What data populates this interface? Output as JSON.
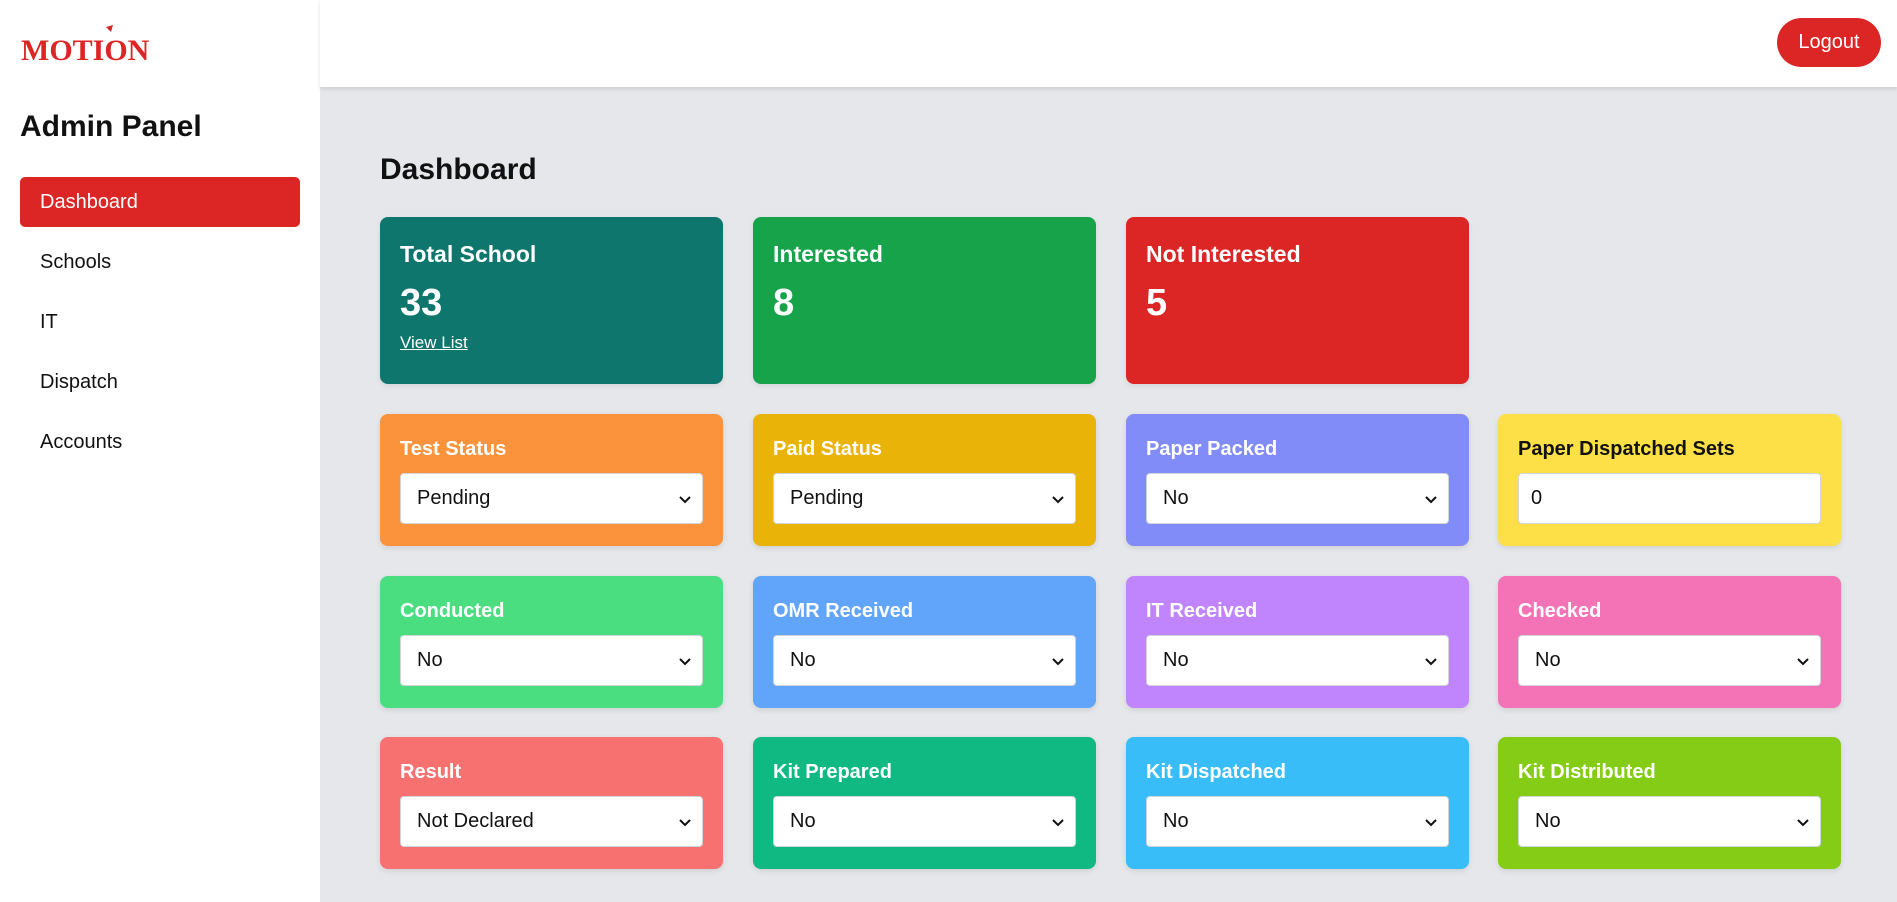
{
  "brand": {
    "logo_text": "MOTION",
    "accent": "#dc2626"
  },
  "header": {
    "logout_label": "Logout"
  },
  "sidebar": {
    "title": "Admin Panel",
    "items": [
      {
        "label": "Dashboard",
        "active": true
      },
      {
        "label": "Schools",
        "active": false
      },
      {
        "label": "IT",
        "active": false
      },
      {
        "label": "Dispatch",
        "active": false
      },
      {
        "label": "Accounts",
        "active": false
      }
    ]
  },
  "main": {
    "title": "Dashboard",
    "stats": [
      {
        "label": "Total School",
        "value": "33",
        "link": "View List",
        "color": "#0f766e"
      },
      {
        "label": "Interested",
        "value": "8",
        "color": "#16a34a"
      },
      {
        "label": "Not Interested",
        "value": "5",
        "color": "#dc2626"
      }
    ],
    "controls": [
      {
        "label": "Test Status",
        "value": "Pending",
        "type": "select",
        "color": "#fb923c"
      },
      {
        "label": "Paid Status",
        "value": "Pending",
        "type": "select",
        "color": "#eab308"
      },
      {
        "label": "Paper Packed",
        "value": "No",
        "type": "select",
        "color": "#818cf8"
      },
      {
        "label": "Paper Dispatched Sets",
        "value": "0",
        "type": "input",
        "color": "#fde047"
      },
      {
        "label": "Conducted",
        "value": "No",
        "type": "select",
        "color": "#4ade80"
      },
      {
        "label": "OMR Received",
        "value": "No",
        "type": "select",
        "color": "#60a5fa"
      },
      {
        "label": "IT Received",
        "value": "No",
        "type": "select",
        "color": "#c084fc"
      },
      {
        "label": "Checked",
        "value": "No",
        "type": "select",
        "color": "#f472b6"
      },
      {
        "label": "Result",
        "value": "Not Declared",
        "type": "select",
        "color": "#f87171"
      },
      {
        "label": "Kit Prepared",
        "value": "No",
        "type": "select",
        "color": "#10b981"
      },
      {
        "label": "Kit Dispatched",
        "value": "No",
        "type": "select",
        "color": "#38bdf8"
      },
      {
        "label": "Kit Distributed",
        "value": "No",
        "type": "select",
        "color": "#84cc16"
      }
    ]
  }
}
